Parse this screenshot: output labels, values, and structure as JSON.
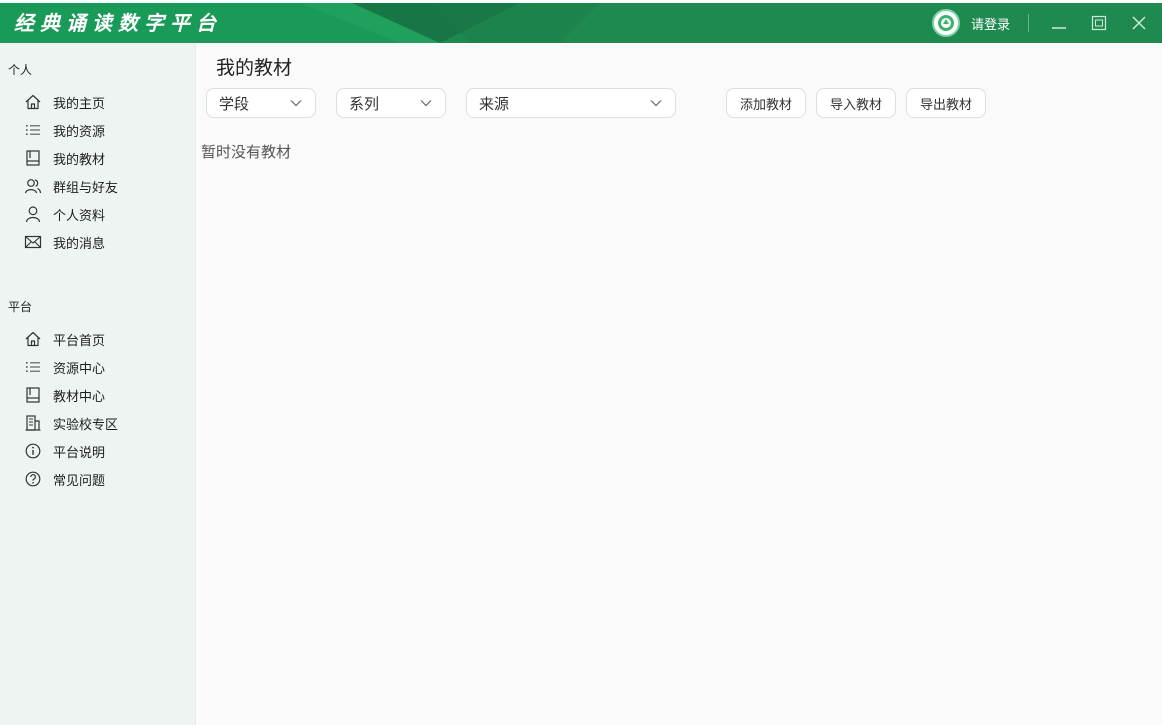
{
  "app": {
    "title": "经典诵读数字平台",
    "login_label": "请登录"
  },
  "colors": {
    "titlebar": "#1f8a50",
    "sidebar_bg": "#eef4f1",
    "main_bg": "#fafafa"
  },
  "sidebar": {
    "personal_label": "个人",
    "personal_items": [
      {
        "label": "我的主页",
        "icon": "home-icon"
      },
      {
        "label": "我的资源",
        "icon": "list-icon"
      },
      {
        "label": "我的教材",
        "icon": "book-icon"
      },
      {
        "label": "群组与好友",
        "icon": "users-icon"
      },
      {
        "label": "个人资料",
        "icon": "user-icon"
      },
      {
        "label": "我的消息",
        "icon": "mail-icon"
      }
    ],
    "platform_label": "平台",
    "platform_items": [
      {
        "label": "平台首页",
        "icon": "home-icon"
      },
      {
        "label": "资源中心",
        "icon": "list-icon"
      },
      {
        "label": "教材中心",
        "icon": "book-icon"
      },
      {
        "label": "实验校专区",
        "icon": "building-icon"
      },
      {
        "label": "平台说明",
        "icon": "info-icon"
      },
      {
        "label": "常见问题",
        "icon": "help-icon"
      }
    ]
  },
  "main": {
    "title": "我的教材",
    "filters": {
      "stage": "学段",
      "series": "系列",
      "source": "来源"
    },
    "buttons": {
      "add": "添加教材",
      "import": "导入教材",
      "export": "导出教材"
    },
    "empty_text": "暂时没有教材"
  }
}
